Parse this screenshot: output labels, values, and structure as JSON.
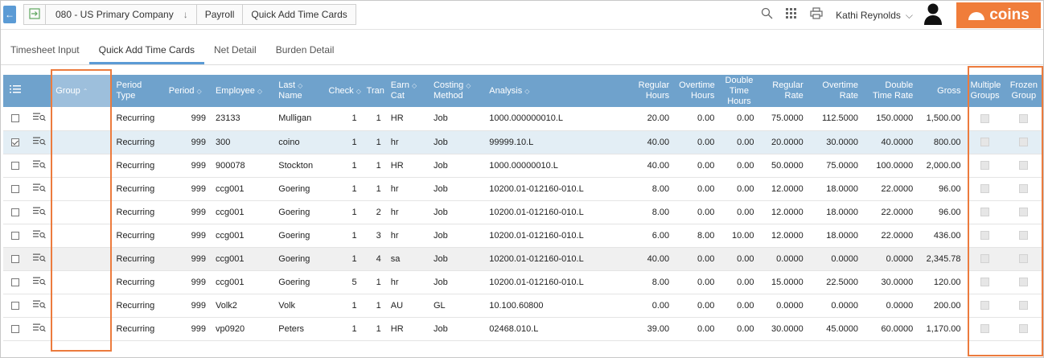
{
  "topbar": {
    "company": "080 - US Primary Company",
    "module": "Payroll",
    "page": "Quick Add Time Cards",
    "user": "Kathi Reynolds",
    "logo_text": "coins",
    "icons": [
      "back-arrow-icon",
      "exit-icon",
      "search-icon",
      "grid-menu-icon",
      "printer-icon",
      "user-avatar-icon",
      "chevron-down-icon"
    ],
    "accent_color": "#5b9bd5",
    "logo_color": "#f07d3a"
  },
  "tabs": [
    {
      "label": "Timesheet Input",
      "active": false
    },
    {
      "label": "Quick Add Time Cards",
      "active": true
    },
    {
      "label": "Net Detail",
      "active": false
    },
    {
      "label": "Burden Detail",
      "active": false
    }
  ],
  "columns": {
    "group": "Group",
    "period_type": [
      "Period",
      "Type"
    ],
    "period": "Period",
    "employee": "Employee",
    "last_name": [
      "Last",
      "Name"
    ],
    "check": "Check",
    "tran": "Tran",
    "earn_cat": [
      "Earn",
      "Cat"
    ],
    "costing_method": [
      "Costing",
      "Method"
    ],
    "analysis": "Analysis",
    "regular_hours": [
      "Regular",
      "Hours"
    ],
    "overtime_hours": [
      "Overtime",
      "Hours"
    ],
    "double_time_hours": [
      "Double",
      "Time",
      "Hours"
    ],
    "regular_rate": [
      "Regular",
      "Rate"
    ],
    "overtime_rate": [
      "Overtime",
      "Rate"
    ],
    "double_time_rate": [
      "Double",
      "Time Rate"
    ],
    "gross": "Gross",
    "multiple_groups": [
      "Multiple",
      "Groups"
    ],
    "frozen_group": [
      "Frozen",
      "Group"
    ]
  },
  "rows": [
    {
      "checked": false,
      "group": "",
      "period_type": "Recurring",
      "period": "999",
      "employee": "23133",
      "last_name": "Mulligan",
      "check": "1",
      "tran": "1",
      "earn_cat": "HR",
      "costing_method": "Job",
      "analysis": "1000.000000010.L",
      "regular_hours": "20.00",
      "overtime_hours": "0.00",
      "double_time_hours": "0.00",
      "regular_rate": "75.0000",
      "overtime_rate": "112.5000",
      "double_time_rate": "150.0000",
      "gross": "1,500.00"
    },
    {
      "checked": true,
      "group": "",
      "period_type": "Recurring",
      "period": "999",
      "employee": "300",
      "last_name": "coino",
      "check": "1",
      "tran": "1",
      "earn_cat": "hr",
      "costing_method": "Job",
      "analysis": "99999.10.L",
      "regular_hours": "40.00",
      "overtime_hours": "0.00",
      "double_time_hours": "0.00",
      "regular_rate": "20.0000",
      "overtime_rate": "30.0000",
      "double_time_rate": "40.0000",
      "gross": "800.00"
    },
    {
      "checked": false,
      "group": "",
      "period_type": "Recurring",
      "period": "999",
      "employee": "900078",
      "last_name": "Stockton",
      "check": "1",
      "tran": "1",
      "earn_cat": "HR",
      "costing_method": "Job",
      "analysis": "1000.00000010.L",
      "regular_hours": "40.00",
      "overtime_hours": "0.00",
      "double_time_hours": "0.00",
      "regular_rate": "50.0000",
      "overtime_rate": "75.0000",
      "double_time_rate": "100.0000",
      "gross": "2,000.00"
    },
    {
      "checked": false,
      "group": "",
      "period_type": "Recurring",
      "period": "999",
      "employee": "ccg001",
      "last_name": "Goering",
      "check": "1",
      "tran": "1",
      "earn_cat": "hr",
      "costing_method": "Job",
      "analysis": "10200.01-012160-010.L",
      "regular_hours": "8.00",
      "overtime_hours": "0.00",
      "double_time_hours": "0.00",
      "regular_rate": "12.0000",
      "overtime_rate": "18.0000",
      "double_time_rate": "22.0000",
      "gross": "96.00"
    },
    {
      "checked": false,
      "group": "",
      "period_type": "Recurring",
      "period": "999",
      "employee": "ccg001",
      "last_name": "Goering",
      "check": "1",
      "tran": "2",
      "earn_cat": "hr",
      "costing_method": "Job",
      "analysis": "10200.01-012160-010.L",
      "regular_hours": "8.00",
      "overtime_hours": "0.00",
      "double_time_hours": "0.00",
      "regular_rate": "12.0000",
      "overtime_rate": "18.0000",
      "double_time_rate": "22.0000",
      "gross": "96.00"
    },
    {
      "checked": false,
      "group": "",
      "period_type": "Recurring",
      "period": "999",
      "employee": "ccg001",
      "last_name": "Goering",
      "check": "1",
      "tran": "3",
      "earn_cat": "hr",
      "costing_method": "Job",
      "analysis": "10200.01-012160-010.L",
      "regular_hours": "6.00",
      "overtime_hours": "8.00",
      "double_time_hours": "10.00",
      "regular_rate": "12.0000",
      "overtime_rate": "18.0000",
      "double_time_rate": "22.0000",
      "gross": "436.00"
    },
    {
      "checked": false,
      "group": "",
      "period_type": "Recurring",
      "period": "999",
      "employee": "ccg001",
      "last_name": "Goering",
      "check": "1",
      "tran": "4",
      "earn_cat": "sa",
      "costing_method": "Job",
      "analysis": "10200.01-012160-010.L",
      "regular_hours": "40.00",
      "overtime_hours": "0.00",
      "double_time_hours": "0.00",
      "regular_rate": "0.0000",
      "overtime_rate": "0.0000",
      "double_time_rate": "0.0000",
      "gross": "2,345.78"
    },
    {
      "checked": false,
      "group": "",
      "period_type": "Recurring",
      "period": "999",
      "employee": "ccg001",
      "last_name": "Goering",
      "check": "5",
      "tran": "1",
      "earn_cat": "hr",
      "costing_method": "Job",
      "analysis": "10200.01-012160-010.L",
      "regular_hours": "8.00",
      "overtime_hours": "0.00",
      "double_time_hours": "0.00",
      "regular_rate": "15.0000",
      "overtime_rate": "22.5000",
      "double_time_rate": "30.0000",
      "gross": "120.00"
    },
    {
      "checked": false,
      "group": "",
      "period_type": "Recurring",
      "period": "999",
      "employee": "Volk2",
      "last_name": "Volk",
      "check": "1",
      "tran": "1",
      "earn_cat": "AU",
      "costing_method": "GL",
      "analysis": "10.100.60800",
      "regular_hours": "0.00",
      "overtime_hours": "0.00",
      "double_time_hours": "0.00",
      "regular_rate": "0.0000",
      "overtime_rate": "0.0000",
      "double_time_rate": "0.0000",
      "gross": "200.00"
    },
    {
      "checked": false,
      "group": "",
      "period_type": "Recurring",
      "period": "999",
      "employee": "vp0920",
      "last_name": "Peters",
      "check": "1",
      "tran": "1",
      "earn_cat": "HR",
      "costing_method": "Job",
      "analysis": "02468.010.L",
      "regular_hours": "39.00",
      "overtime_hours": "0.00",
      "double_time_hours": "0.00",
      "regular_rate": "30.0000",
      "overtime_rate": "45.0000",
      "double_time_rate": "60.0000",
      "gross": "1,170.00"
    }
  ]
}
